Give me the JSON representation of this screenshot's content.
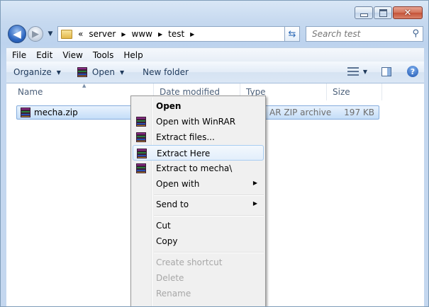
{
  "window": {
    "caption_buttons": {
      "minimize": "minimize",
      "maximize": "maximize",
      "close": "✕"
    }
  },
  "nav": {
    "back_glyph": "◀",
    "forward_glyph": "▶",
    "breadcrumb_prefix": "«",
    "crumbs": [
      "server",
      "www",
      "test"
    ],
    "search_placeholder": "Search test"
  },
  "menubar": {
    "items": [
      "File",
      "Edit",
      "View",
      "Tools",
      "Help"
    ]
  },
  "commandbar": {
    "organize": "Organize",
    "open": "Open",
    "new_folder": "New folder"
  },
  "columns": {
    "name": "Name",
    "date_modified": "Date modified",
    "type": "Type",
    "size": "Size"
  },
  "files": [
    {
      "name": "mecha.zip",
      "type": "WinRAR ZIP archive",
      "type_visible": "AR ZIP archive",
      "size": "197 KB"
    }
  ],
  "context_menu": {
    "items": [
      {
        "label": "Open",
        "bold": true,
        "icon": "none"
      },
      {
        "label": "Open with WinRAR",
        "icon": "winrar-icon"
      },
      {
        "label": "Extract files...",
        "icon": "winrar-icon"
      },
      {
        "label": "Extract Here",
        "icon": "winrar-icon",
        "highlighted": true
      },
      {
        "label": "Extract to mecha\\",
        "icon": "winrar-icon"
      },
      {
        "label": "Open with",
        "submenu": true
      },
      {
        "label": "Send to",
        "submenu": true
      },
      {
        "label": "Cut"
      },
      {
        "label": "Copy"
      },
      {
        "label": "Create shortcut",
        "disabled": true
      },
      {
        "label": "Delete",
        "disabled": true
      },
      {
        "label": "Rename",
        "disabled": true
      }
    ]
  },
  "colors": {
    "accent": "#3a6ea5",
    "selection": "#c4ddf8",
    "menu_bg": "#f0f0f0"
  }
}
